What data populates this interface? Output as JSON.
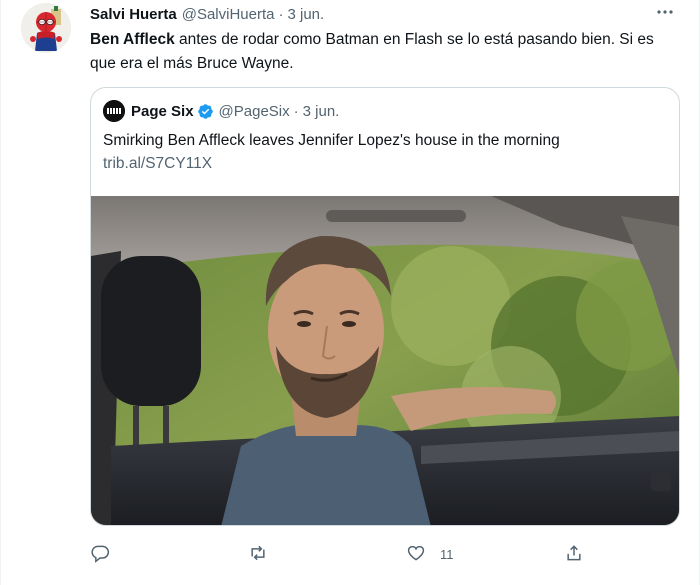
{
  "tweet": {
    "author_name": "Salvi Huerta",
    "author_handle": "@SalviHuerta",
    "separator": "·",
    "date": "3 jun.",
    "text_bold": "Ben Affleck",
    "text_rest": " antes de rodar como Batman en Flash se lo está pasando bien. Si es que era el más Bruce Wayne.",
    "more_icon": "more-dots-icon"
  },
  "quoted_tweet": {
    "author_name": "Page Six",
    "author_handle": "@PageSix",
    "separator": "·",
    "date": "3 jun.",
    "text": "Smirking Ben Affleck leaves Jennifer Lopez's house in the morning",
    "link": "trib.al/S7CY11X",
    "verified": true
  },
  "actions": {
    "reply_count": "",
    "retweet_count": "",
    "like_count": "11",
    "share_count": ""
  },
  "colors": {
    "text": "#0f1419",
    "secondary": "#536471",
    "border": "#cfd9de",
    "verified": "#1d9bf0"
  }
}
